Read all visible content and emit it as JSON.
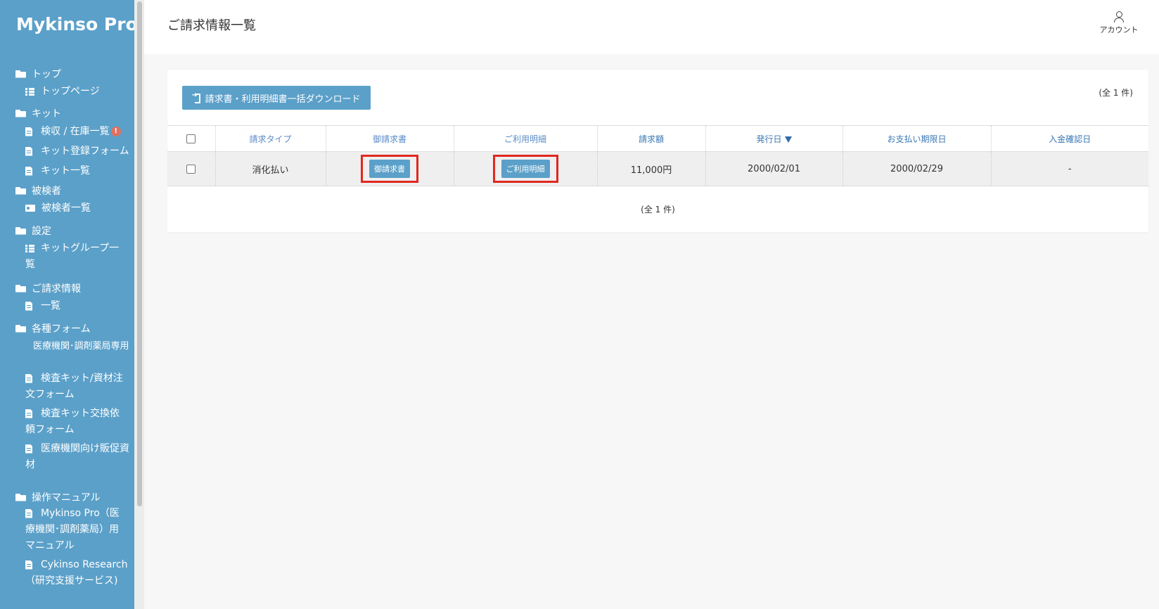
{
  "brand": "Mykinso Pro",
  "sidebar": {
    "groups": [
      {
        "title": "トップ"
      },
      {
        "title": "キット"
      },
      {
        "title": "被検者"
      },
      {
        "title": "設定"
      },
      {
        "title": "ご請求情報"
      },
      {
        "title": "各種フォーム"
      },
      {
        "title": "操作マニュアル"
      }
    ],
    "items": {
      "top_page": "トップページ",
      "kit_collect": "検収 / 在庫一覧",
      "kit_collect_badge": "!",
      "kit_register": "キット登録フォーム",
      "kit_list": "キット一覧",
      "subject_list": "被検者一覧",
      "kit_group_list": "キットグループ一覧",
      "billing_list": "一覧",
      "forms_subtitle": "医療機関･調剤薬局専用",
      "form_order": "検査キット/資材注文フォーム",
      "form_exchange": "検査キット交換依頼フォーム",
      "form_promo": "医療機関向け販促資材",
      "manual_pro": "Mykinso Pro（医療機関･調剤薬局）用マニュアル",
      "manual_cykinso": "Cykinso Research（研究支援サービス)"
    }
  },
  "header": {
    "title": "ご請求情報一覧",
    "account_label": "アカウント"
  },
  "main": {
    "bulk_download_label": "請求書・利用明細書一括ダウンロード",
    "count_label": "(全 1 件)",
    "table": {
      "headers": [
        "請求タイプ",
        "御請求書",
        "ご利用明細",
        "請求額",
        "発行日",
        "お支払い期限日",
        "入金確認日"
      ],
      "rows": [
        {
          "type": "消化払い",
          "invoice_button": "御請求書",
          "detail_button": "ご利用明細",
          "amount": "11,000円",
          "issued": "2000/02/01",
          "due": "2000/02/29",
          "paid": "-"
        }
      ]
    }
  }
}
